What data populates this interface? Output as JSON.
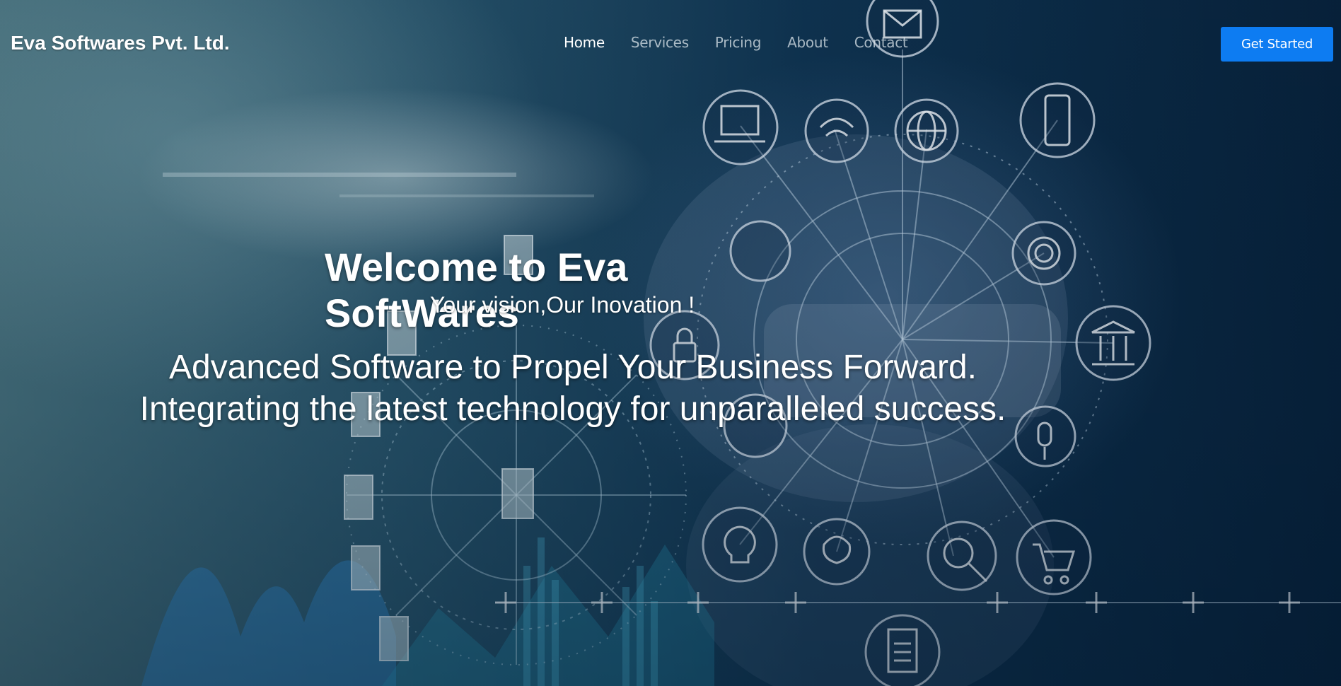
{
  "header": {
    "brand": "Eva Softwares Pvt. Ltd.",
    "nav": [
      {
        "label": "Home",
        "active": true
      },
      {
        "label": "Services",
        "active": false
      },
      {
        "label": "Pricing",
        "active": false
      },
      {
        "label": "About",
        "active": false
      },
      {
        "label": "Contact",
        "active": false
      }
    ],
    "cta_label": "Get Started"
  },
  "hero": {
    "title": "Welcome to Eva SoftWares",
    "tagline": "Your vision,Our Inovation !",
    "line1": "Advanced Software to Propel Your Business Forward.",
    "line2": "Integrating the latest technology for unparalleled success."
  },
  "colors": {
    "accent": "#0d7cf2",
    "text": "#ffffff",
    "nav_inactive": "#c8d4da"
  },
  "background_icons": [
    "mail-icon",
    "laptop-icon",
    "wifi-icon",
    "globe-icon",
    "phone-icon",
    "gear-icon",
    "bank-icon",
    "lock-icon",
    "lightbulb-icon",
    "brain-icon",
    "search-chart-icon",
    "cart-icon",
    "document-icon",
    "person-icon",
    "location-icon",
    "microphone-icon"
  ]
}
